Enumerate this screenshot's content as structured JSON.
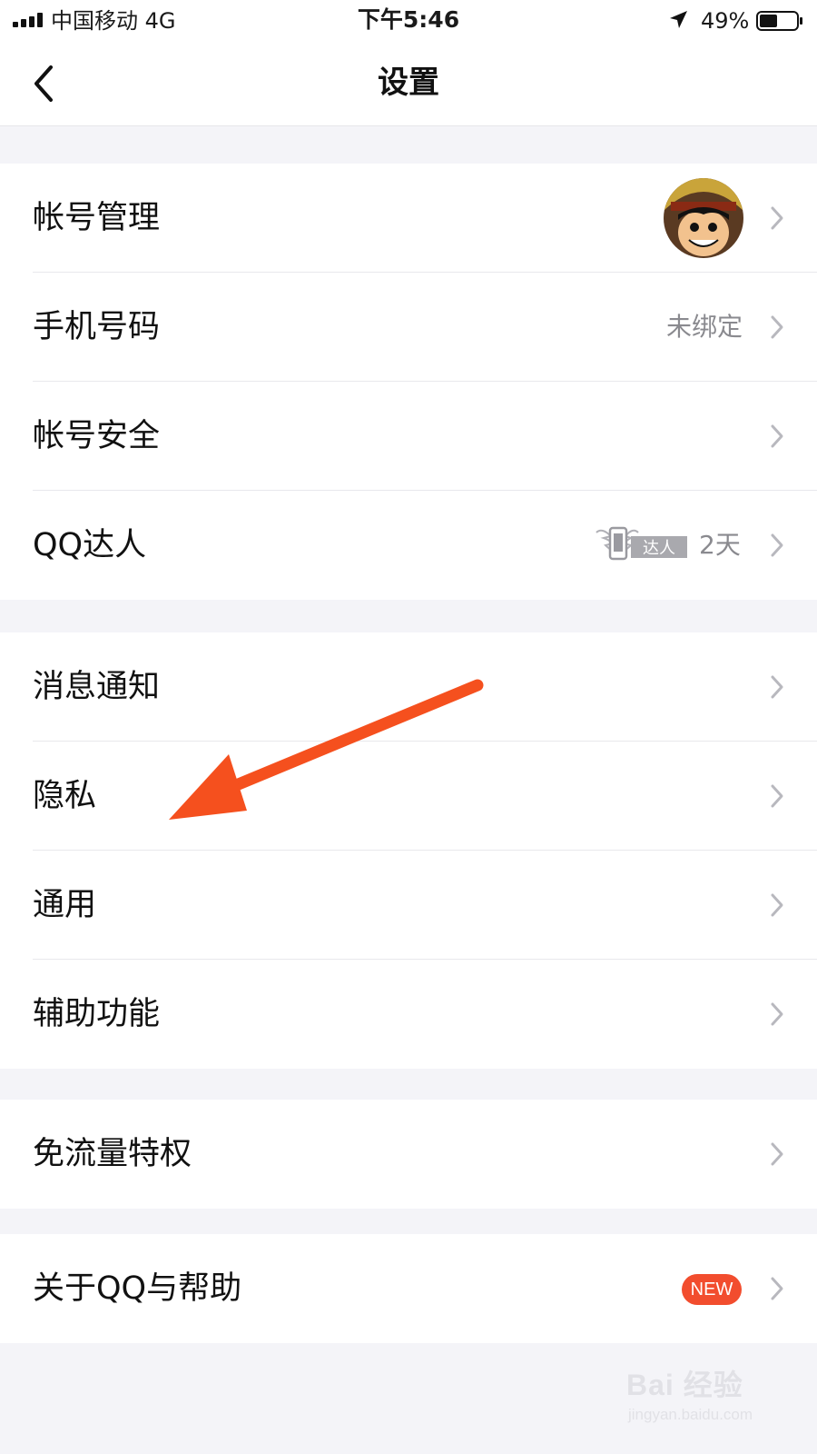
{
  "status_bar": {
    "carrier": "中国移动   4G",
    "time": "下午5:46",
    "battery_percent": "49%",
    "battery_level": 0.49
  },
  "nav": {
    "title": "设置",
    "back_icon": "chevron-left-icon"
  },
  "groups": [
    {
      "rows": [
        {
          "label": "帐号管理"
        },
        {
          "label": "手机号码",
          "value": "未绑定"
        },
        {
          "label": "帐号安全"
        },
        {
          "label": "QQ达人",
          "badge_text": "达人",
          "value": "2天"
        }
      ]
    },
    {
      "rows": [
        {
          "label": "消息通知"
        },
        {
          "label": "隐私"
        },
        {
          "label": "通用"
        },
        {
          "label": "辅助功能"
        }
      ]
    },
    {
      "rows": [
        {
          "label": "免流量特权"
        }
      ]
    },
    {
      "rows": [
        {
          "label": "关于QQ与帮助",
          "badge": "NEW"
        }
      ]
    }
  ],
  "colors": {
    "background": "#f4f4f8",
    "annotation_arrow": "#f5501e",
    "new_badge": "#f24d2e"
  },
  "watermark": {
    "brand": "Bai 经验",
    "url": "jingyan.baidu.com"
  }
}
